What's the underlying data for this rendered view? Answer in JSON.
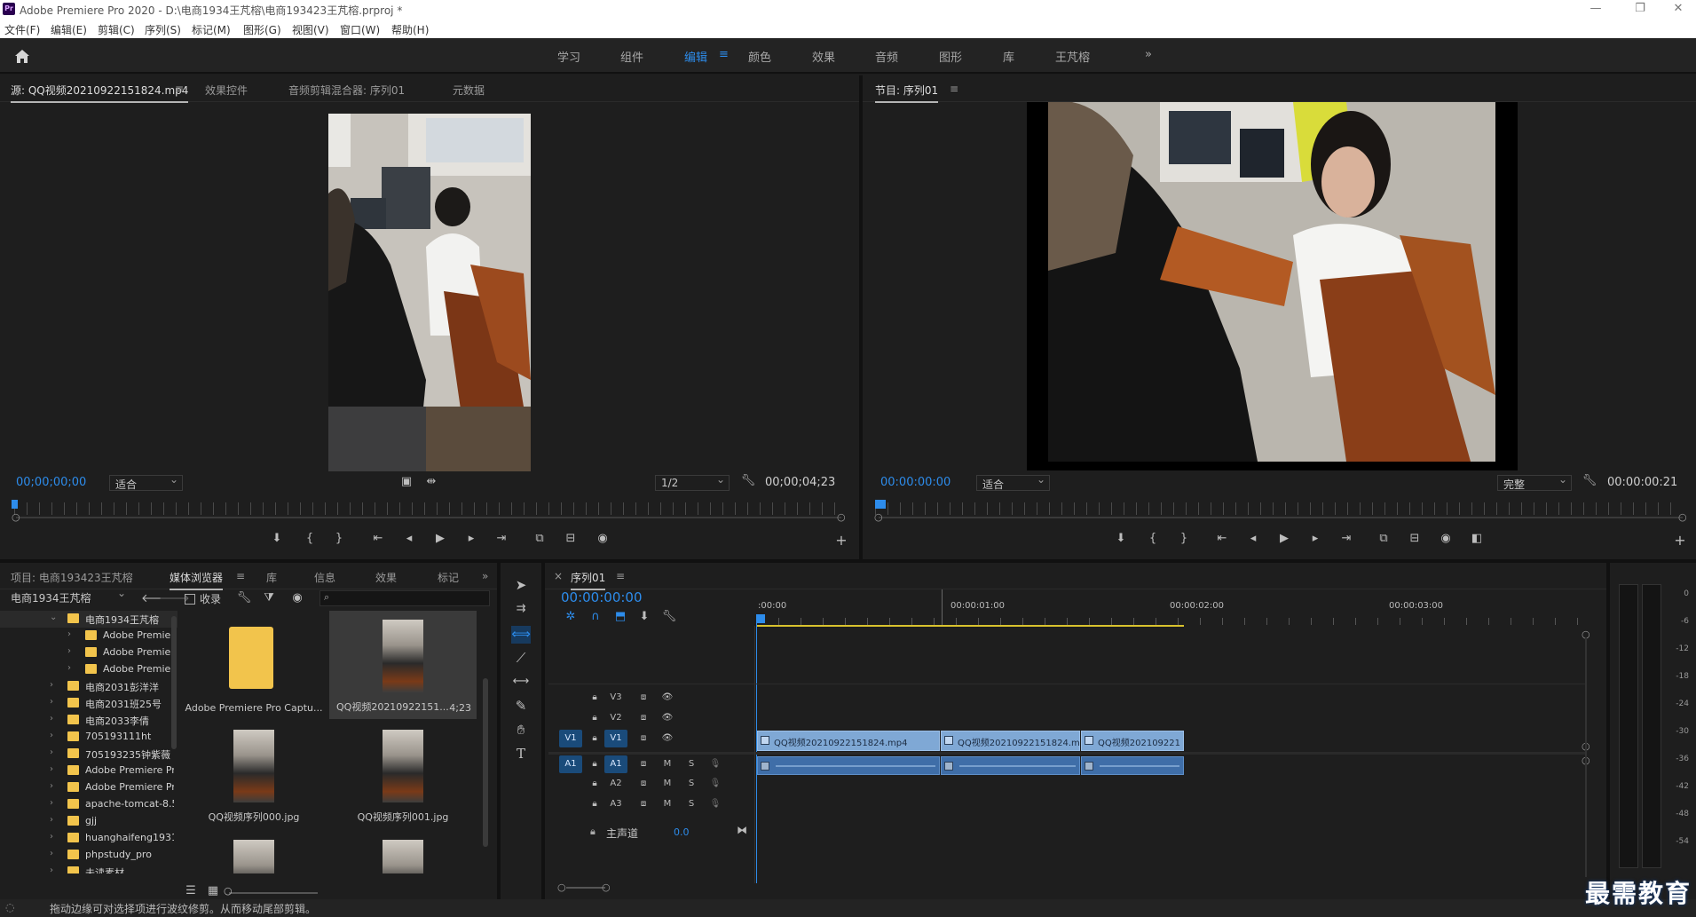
{
  "window": {
    "title": "Adobe Premiere Pro 2020 - D:\\电商1934王芃榕\\电商193423王芃榕.prproj *",
    "app_icon": "Pr",
    "minimize": "—",
    "restore": "❐",
    "close": "✕"
  },
  "menu": [
    "文件(F)",
    "编辑(E)",
    "剪辑(C)",
    "序列(S)",
    "标记(M)",
    "图形(G)",
    "视图(V)",
    "窗口(W)",
    "帮助(H)"
  ],
  "workspaces": [
    "学习",
    "组件",
    "编辑",
    "颜色",
    "效果",
    "音频",
    "图形",
    "库",
    "王芃榕",
    "»"
  ],
  "workspace_active": "编辑",
  "workspace_menu_icon": "≡",
  "source_panel": {
    "tabs": [
      "源: QQ视频20210922151824.mp4",
      "效果控件",
      "音频剪辑混合器: 序列01",
      "元数据"
    ],
    "menu_icon": "≡",
    "timecode": "00;00;00;00",
    "fit": "适合",
    "resolution": "1/2",
    "duration": "00;00;04;23"
  },
  "program_panel": {
    "tab": "节目: 序列01",
    "menu_icon": "≡",
    "timecode": "00:00:00:00",
    "fit": "适合",
    "quality": "完整",
    "duration": "00:00:00:21"
  },
  "project_panel": {
    "tabs": [
      "项目: 电商193423王芃榕",
      "媒体浏览器",
      "库",
      "信息",
      "效果",
      "标记",
      "»"
    ],
    "menu_icon": "≡",
    "location": "电商1934王芃榕",
    "favorite_label": "收录",
    "tree": [
      {
        "label": "电商1934王芃榕",
        "level": 0,
        "open": true,
        "selected": true
      },
      {
        "label": "Adobe Premie",
        "level": 1
      },
      {
        "label": "Adobe Premie",
        "level": 1
      },
      {
        "label": "Adobe Premie",
        "level": 1
      },
      {
        "label": "电商2031彭洋洋",
        "level": 0
      },
      {
        "label": "电商2031班25号",
        "level": 0
      },
      {
        "label": "电商2033李倩",
        "level": 0
      },
      {
        "label": "705193111ht",
        "level": 0
      },
      {
        "label": "705193235钟紫薇",
        "level": 0
      },
      {
        "label": "Adobe Premiere Pr",
        "level": 0
      },
      {
        "label": "Adobe Premiere Pr",
        "level": 0
      },
      {
        "label": "apache-tomcat-8.5.",
        "level": 0
      },
      {
        "label": "gjj",
        "level": 0
      },
      {
        "label": "huanghaifeng1931",
        "level": 0
      },
      {
        "label": "phpstudy_pro",
        "level": 0
      },
      {
        "label": "未读素材",
        "level": 0
      }
    ],
    "thumbnails": [
      {
        "caption": "Adobe Premiere Pro Captu...",
        "kind": "folder"
      },
      {
        "caption": "QQ视频20210922151...",
        "kind": "video",
        "duration": "4;23",
        "selected": true
      },
      {
        "caption": "QQ视频序列000.jpg",
        "kind": "image"
      },
      {
        "caption": "QQ视频序列001.jpg",
        "kind": "image"
      },
      {
        "caption": "",
        "kind": "image"
      },
      {
        "caption": "",
        "kind": "image"
      }
    ]
  },
  "timeline": {
    "tab": "序列01",
    "close_icon": "×",
    "menu_icon": "≡",
    "timecode": "00:00:00:00",
    "ruler_labels": [
      ":00:00",
      "00:00:01:00",
      "00:00:02:00",
      "00:00:03:00"
    ],
    "tracks": [
      {
        "name": "V3",
        "type": "video"
      },
      {
        "name": "V2",
        "type": "video"
      },
      {
        "name": "V1",
        "type": "video",
        "source": "V1"
      },
      {
        "name": "A1",
        "type": "audio",
        "source": "A1"
      },
      {
        "name": "A2",
        "type": "audio"
      },
      {
        "name": "A3",
        "type": "audio"
      }
    ],
    "mute_label": "M",
    "solo_label": "S",
    "master": {
      "label": "主声道",
      "value": "0.0"
    },
    "clips": [
      {
        "label": "QQ视频20210922151824.mp4"
      },
      {
        "label": "QQ视频20210922151824.mp"
      },
      {
        "label": "QQ视频202109221"
      }
    ]
  },
  "audio_meter": {
    "scale": [
      "0",
      "-6",
      "-12",
      "-18",
      "-24",
      "-30",
      "-36",
      "-42",
      "-48",
      "-54"
    ]
  },
  "status": "拖动边缘可对选择项进行波纹修剪。从而移动尾部剪辑。",
  "watermark": "最需教育",
  "colors": {
    "accent": "#2d8ceb",
    "clip_video": "#7fa8d5",
    "clip_audio": "#3f6ea8",
    "folder": "#f2c44c"
  }
}
